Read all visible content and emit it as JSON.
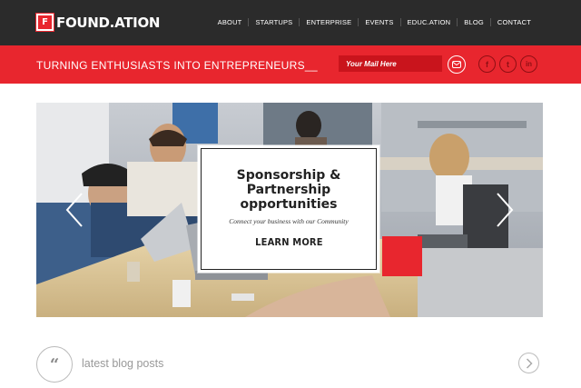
{
  "brand": {
    "mark": "F",
    "name": "FOUND.ATION"
  },
  "nav": {
    "items": [
      "ABOUT",
      "STARTUPS",
      "ENTERPRISE",
      "EVENTS",
      "EDUC.ATION",
      "BLOG",
      "CONTACT"
    ]
  },
  "banner": {
    "tagline": "TURNING ENTHUSIASTS INTO ENTREPRENEURS__",
    "mail_placeholder": "Your Mail Here",
    "social": [
      "f",
      "t",
      "in"
    ]
  },
  "hero": {
    "title": "Sponsorship & Partnership opportunities",
    "subtitle": "Connect your business with our Community",
    "cta": "LEARN MORE"
  },
  "blog": {
    "heading": "latest blog posts",
    "quote_glyph": "“"
  },
  "colors": {
    "accent": "#e8262e",
    "dark": "#2b2b2b"
  }
}
